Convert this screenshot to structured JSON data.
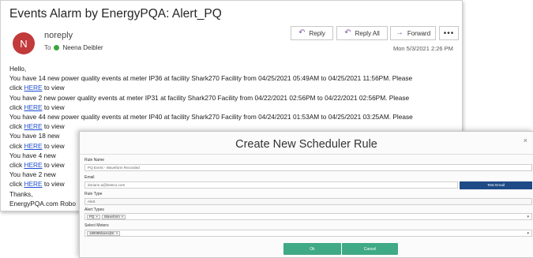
{
  "email": {
    "title": "Events Alarm by EnergyPQA: Alert_PQ",
    "avatar_initial": "N",
    "sender": "noreply",
    "to_label": "To",
    "recipient": "Neena Deibler",
    "date": "Mon 5/3/2021 2:26 PM",
    "actions": {
      "reply": "Reply",
      "reply_all": "Reply All",
      "forward": "Forward",
      "more": "•••"
    },
    "greeting": "Hello,",
    "link_text": "HERE",
    "click_prefix": "click",
    "click_suffix": " to view",
    "events": [
      "You have 14 new power quality events at meter IP36 at facility Shark270 Facility from 04/25/2021 05:49AM to 04/25/2021 11:56PM. Please",
      "You have 2 new power quality events at meter IP31 at facility Shark270 Facility from 04/22/2021 02:56PM to 04/22/2021 02:56PM. Please",
      "You have 44 new power quality events at meter IP40 at facility Shark270 Facility from 04/24/2021 01:53AM to 04/25/2021 03:25AM. Please",
      "You have 18 new",
      "You have 4 new",
      "You have 2 new"
    ],
    "closing": "Thanks,",
    "signature": "EnergyPQA.com Robo"
  },
  "dialog": {
    "title": "Create New Scheduler Rule",
    "close": "×",
    "rule_name_label": "Rule Name",
    "rule_name_value": "PQ Event - Waveform Recorded",
    "email_label": "Email",
    "email_value": "doriann.a@bestco.com",
    "test_email_button": "Test Email",
    "rule_type_label": "Rule Type",
    "rule_type_value": "Alert",
    "alert_types_label": "Alert Types",
    "alert_types": [
      "PQ",
      "Waveform"
    ],
    "chip_remove": "×",
    "select_meters_label": "Select Meters",
    "meters": [
      "180085hares(Dr"
    ],
    "ok_button": "Ok",
    "cancel_button": "Cancel"
  },
  "colors": {
    "avatar": "#c23a3a",
    "link": "#1e4fd0",
    "test_email_button": "#1e4a86",
    "dialog_buttons": "#3faa85",
    "recipient_status": "#3fa43f"
  },
  "icons": {
    "reply": "reply-icon",
    "reply_all": "reply-all-icon",
    "forward": "forward-icon",
    "more": "more-icon",
    "close": "close-icon",
    "dropdown": "chevron-down-icon"
  }
}
